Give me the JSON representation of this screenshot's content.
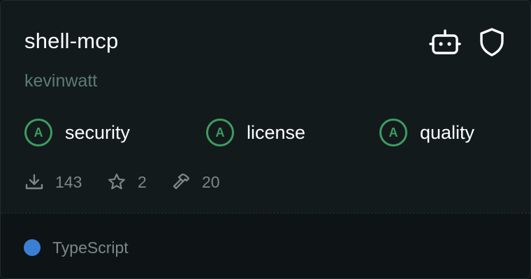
{
  "card": {
    "title": "shell-mcp",
    "author": "kevinwatt",
    "header_icons": [
      "robot-icon",
      "shield-icon"
    ]
  },
  "grades": [
    {
      "grade": "A",
      "label": "security"
    },
    {
      "grade": "A",
      "label": "license"
    },
    {
      "grade": "A",
      "label": "quality"
    }
  ],
  "stats": {
    "downloads": "143",
    "stars": "2",
    "tools": "20"
  },
  "footer": {
    "language": "TypeScript",
    "language_color": "#3b7fd4"
  },
  "colors": {
    "grade_green": "#3e9c60",
    "author_color": "#5f7a73"
  }
}
